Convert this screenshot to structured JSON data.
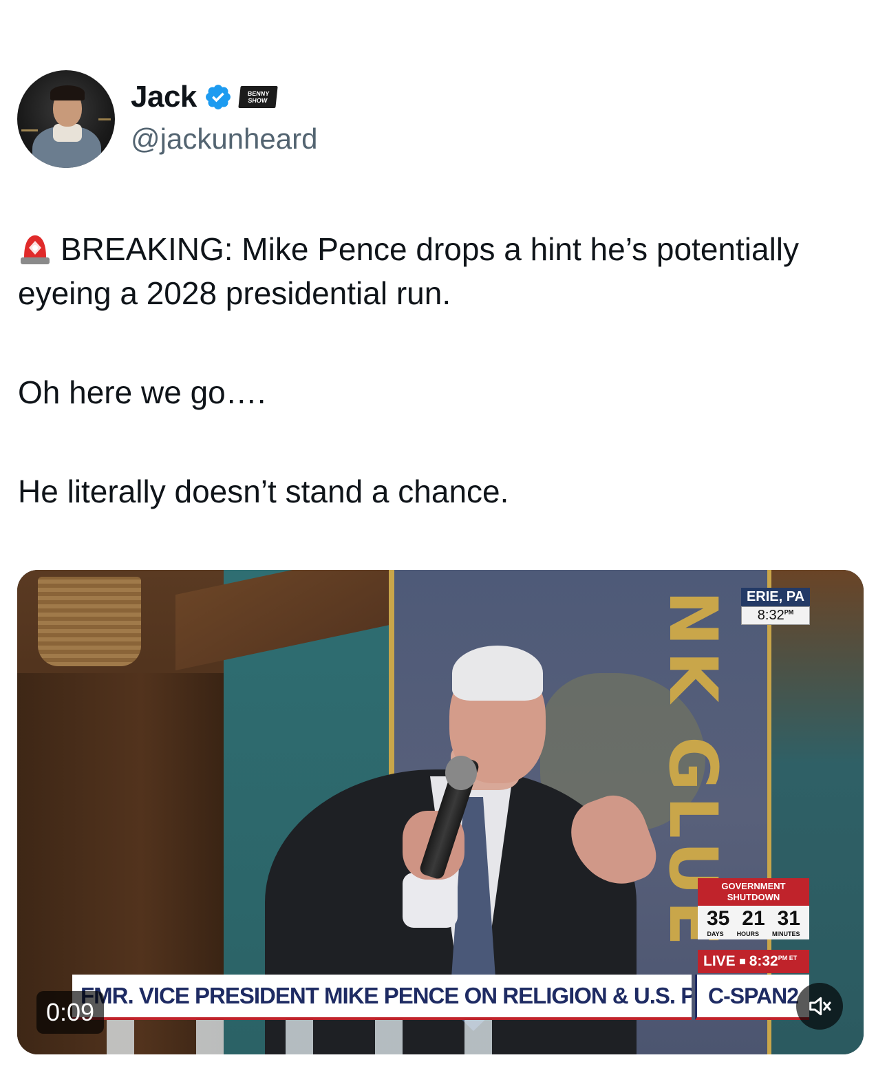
{
  "author": {
    "name": "Jack",
    "handle": "@jackunheard",
    "affiliate_badge": [
      "BENNY",
      "SHOW"
    ]
  },
  "tweet": {
    "paragraphs": [
      "BREAKING: Mike Pence drops a hint he’s potentially eyeing a 2028 presidential run.",
      "Oh here we go….",
      "He literally doesn’t stand a chance."
    ]
  },
  "video": {
    "timestamp": "0:09",
    "location": "ERIE, PA",
    "location_time": "8:32",
    "location_time_suffix": "PM",
    "shutdown_title": "GOVERNMENT SHUTDOWN",
    "shutdown_days": "35",
    "shutdown_hours": "21",
    "shutdown_minutes": "31",
    "shutdown_days_label": "DAYS",
    "shutdown_hours_label": "HOURS",
    "shutdown_minutes_label": "MINUTES",
    "live_label": "LIVE",
    "live_time": "8:32",
    "live_time_suffix": "PM ET",
    "ticker": "FMR. VICE PRESIDENT MIKE PENCE ON RELIGION & U.S. POLITICS",
    "network": "C-SPAN2",
    "background_text": "NK GLUE"
  },
  "colors": {
    "verified": "#1d9bf0",
    "cspan_red": "#c0232b",
    "cspan_navy": "#1e2b63",
    "handle_gray": "#536471"
  }
}
